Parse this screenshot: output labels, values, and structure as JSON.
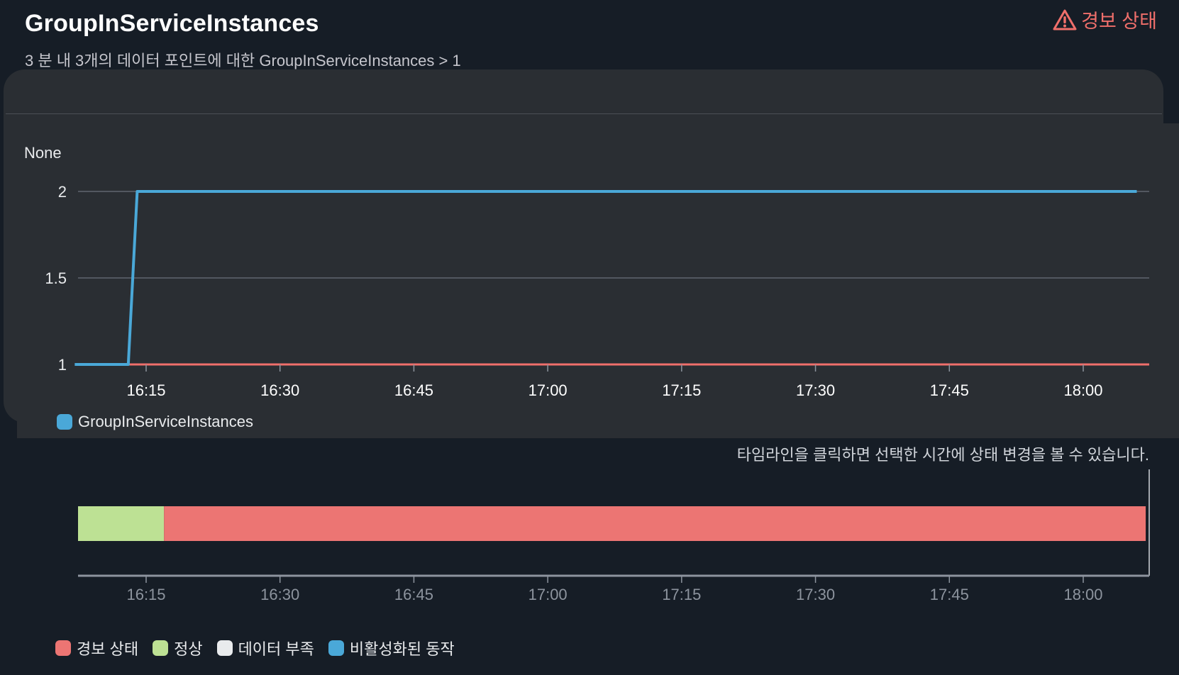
{
  "header": {
    "title": "GroupInServiceInstances",
    "subtitle": "3 분 내 3개의 데이터 포인트에 대한 GroupInServiceInstances > 1",
    "state_label": "경보 상태",
    "state_icon": "warning-triangle-icon"
  },
  "chart_data": {
    "type": "line",
    "unit": "None",
    "x_ticks": [
      "16:15",
      "16:30",
      "16:45",
      "17:00",
      "17:15",
      "17:30",
      "17:45",
      "18:00"
    ],
    "y_ticks": [
      "2",
      "1.5",
      "1"
    ],
    "ylim": [
      1,
      2
    ],
    "grid": true,
    "series": [
      {
        "name": "GroupInServiceInstances",
        "color": "#4aa8d8",
        "points": [
          [
            "16:07",
            1
          ],
          [
            "16:13",
            1
          ],
          [
            "16:14",
            2
          ],
          [
            "18:06",
            2
          ]
        ]
      }
    ],
    "threshold": {
      "value": 1,
      "color": "#f06f6b"
    },
    "legend_position": "bottom-left"
  },
  "timeline": {
    "hint": "타임라인을 클릭하면 선택한 시간에 상태 변경을 볼 수 있습니다.",
    "segments": [
      {
        "state": "정상",
        "start": "16:07",
        "end": "16:17",
        "color": "#bde194"
      },
      {
        "state": "경보 상태",
        "start": "16:17",
        "end": "18:07",
        "color": "#ec7573"
      }
    ],
    "x_ticks": [
      "16:15",
      "16:30",
      "16:45",
      "17:00",
      "17:15",
      "17:30",
      "17:45",
      "18:00"
    ]
  },
  "legend": [
    {
      "label": "경보 상태",
      "color": "#ec7573"
    },
    {
      "label": "정상",
      "color": "#bde194"
    },
    {
      "label": "데이터 부족",
      "color": "#e9ebed"
    },
    {
      "label": "비활성화된 동작",
      "color": "#4aa8d8"
    }
  ]
}
